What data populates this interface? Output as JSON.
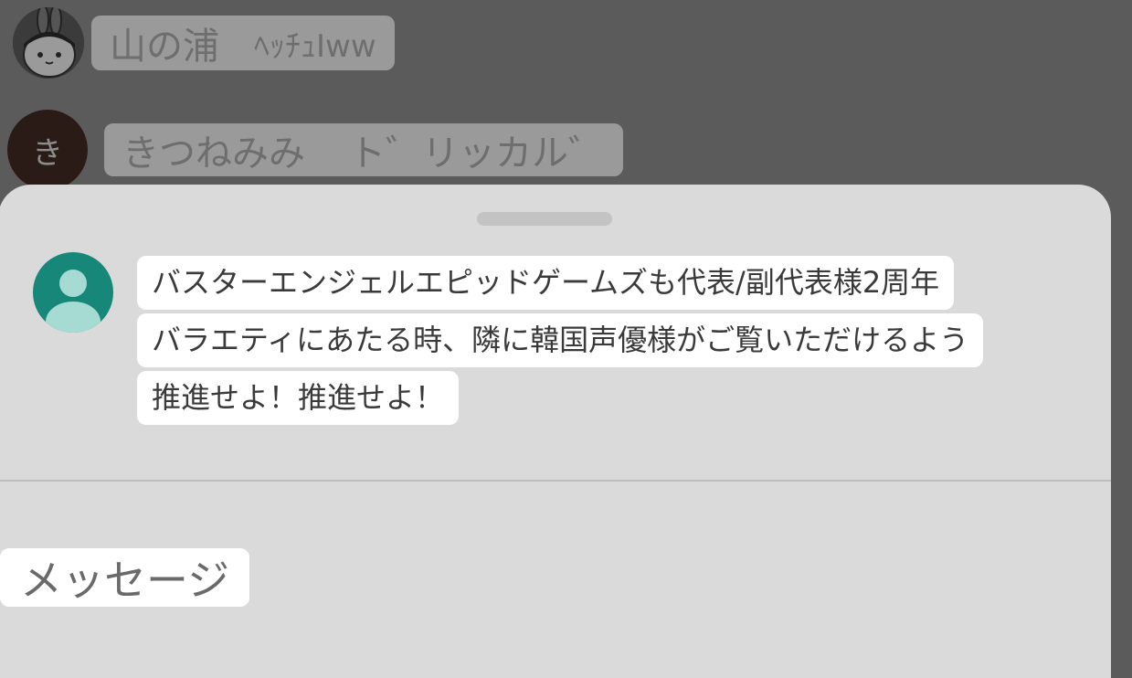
{
  "background_messages": [
    {
      "name": "山の浦",
      "text": "ﾍｯﾁｭIww"
    },
    {
      "avatar_letter": "き",
      "name": "きつねみみ",
      "text": "ト゛リッカル゛"
    }
  ],
  "sheet": {
    "message_lines": [
      "バスターエンジェルエピッドゲームズも代表/副代表様2周年",
      "バラエティにあたる時、隣に韓国声優様がご覧いただけるよう",
      "推進せよ！推進せよ！"
    ],
    "input_placeholder": "メッセージ"
  },
  "colors": {
    "overlay": "#5b5b5b",
    "sheet": "#dadada",
    "avatar_teal": "#178779"
  }
}
